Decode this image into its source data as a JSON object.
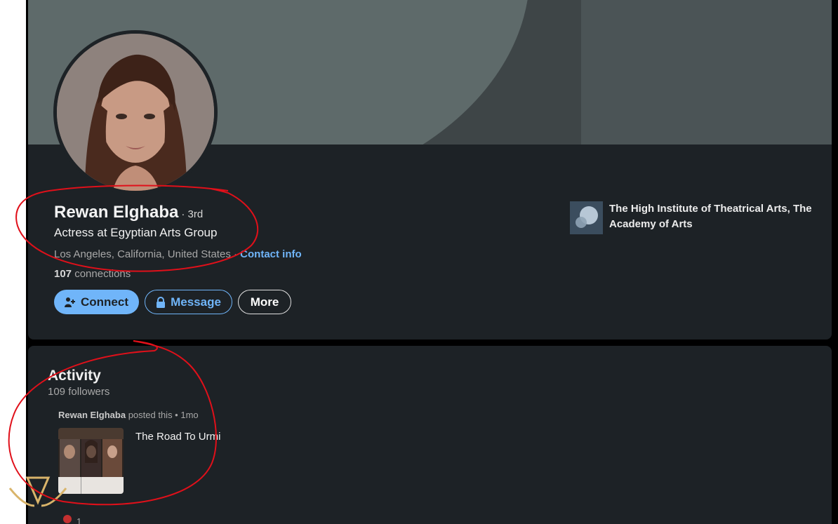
{
  "profile": {
    "name": "Rewan Elghaba",
    "degree": "· 3rd",
    "headline": "Actress at Egyptian Arts Group",
    "location": "Los Angeles, California, United States",
    "location_separator": " · ",
    "contact_info": "Contact info",
    "connections_count": "107",
    "connections_label": " connections",
    "buttons": {
      "connect": "Connect",
      "message": "Message",
      "more": "More"
    },
    "education": "The High Institute of Theatrical Arts, The Academy of Arts"
  },
  "activity": {
    "title": "Activity",
    "followers": "109 followers",
    "post_author": "Rewan Elghaba",
    "post_meta": " posted this • 1mo",
    "post_title": "The Road To Urmi",
    "reaction_count": "1"
  },
  "colors": {
    "accent": "#70b5f9",
    "card_bg": "#1d2226",
    "annotation_red": "#e0101a"
  },
  "icons": {
    "connect": "add-person-icon",
    "message": "lock-icon",
    "education": "school-logo-icon",
    "reaction": "heart-reaction-icon"
  }
}
